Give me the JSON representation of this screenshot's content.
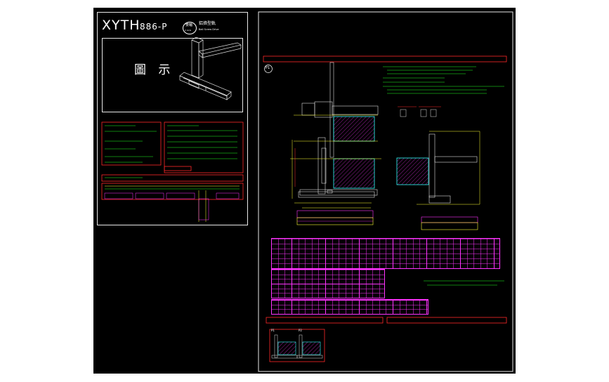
{
  "titleblock": {
    "brand": "XYTH",
    "model": "886-P",
    "badge_top": "雙軸",
    "badge_bottom": "2 Axis",
    "subtitle_cn": "鋁擠型軌",
    "subtitle_en": "Ball Screw Drive",
    "diagram_label": "圖 示"
  },
  "sheet_labels": {
    "p1_tag": "P1",
    "thumb1": "P1",
    "thumb2": "P2"
  },
  "colors": {
    "background": "#000000",
    "frame": "#e8e8e8",
    "accent_red": "#ff2a2a",
    "green": "#22ff22",
    "yellow": "#ffff33",
    "magenta": "#ff33ff",
    "cyan": "#33ffff"
  }
}
